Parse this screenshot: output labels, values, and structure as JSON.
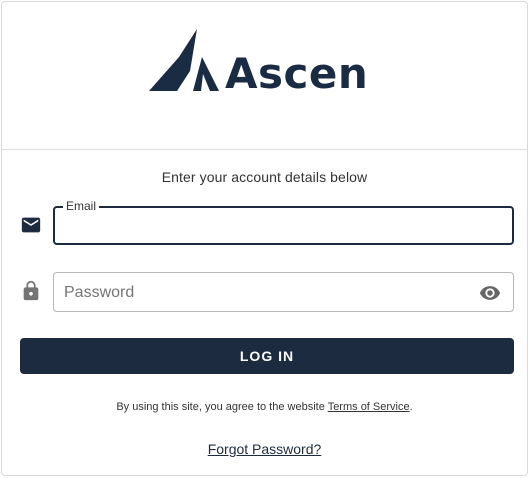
{
  "brand": {
    "name": "Ascen",
    "color": "#1a2b44",
    "logo_icon": "mountain-logo-icon"
  },
  "login": {
    "subtitle": "Enter your account details below",
    "email": {
      "label": "Email",
      "value": "",
      "icon": "mail-icon"
    },
    "password": {
      "placeholder": "Password",
      "value": "",
      "icon": "lock-icon",
      "toggle_icon": "eye-icon"
    },
    "submit_label": "LOG IN",
    "terms": {
      "prefix": "By using this site, you agree to the website ",
      "link_text": "Terms of Service",
      "suffix": "."
    },
    "forgot_password_label": "Forgot Password?"
  },
  "colors": {
    "primary": "#1c2b40",
    "border": "#b8b8b8",
    "text": "#333333"
  }
}
